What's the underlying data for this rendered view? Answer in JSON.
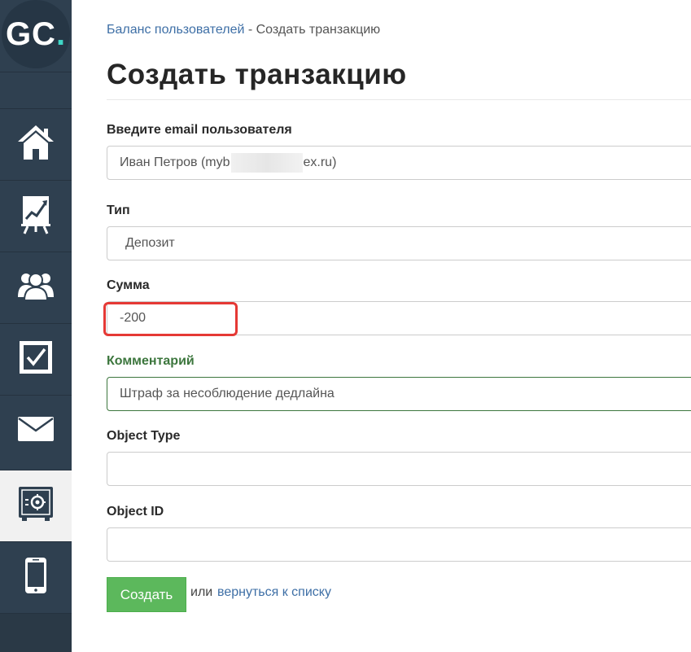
{
  "logo": {
    "letters": "GC",
    "dot": "."
  },
  "sidebar": {
    "items": [
      {
        "icon": "home-icon"
      },
      {
        "icon": "chart-board-icon"
      },
      {
        "icon": "users-icon"
      },
      {
        "icon": "checkbox-icon"
      },
      {
        "icon": "mail-icon"
      },
      {
        "icon": "safe-icon",
        "active": true
      },
      {
        "icon": "mobile-icon"
      }
    ]
  },
  "breadcrumb": {
    "parent": "Баланс пользователей",
    "separator": " - ",
    "current": "Создать транзакцию"
  },
  "page_title": "Создать транзакцию",
  "form": {
    "email": {
      "label": "Введите email пользователя",
      "value_prefix": "Иван Петров (myb",
      "value_suffix": "ex.ru)"
    },
    "type": {
      "label": "Тип",
      "value": "Депозит"
    },
    "amount": {
      "label": "Сумма",
      "value": "-200"
    },
    "comment": {
      "label": "Комментарий",
      "value": "Штраф за несоблюдение дедлайна"
    },
    "object_type": {
      "label": "Object Type",
      "value": ""
    },
    "object_id": {
      "label": "Object ID",
      "value": ""
    }
  },
  "actions": {
    "submit_label": "Создать",
    "or_text": "или",
    "back_link": "вернуться к списку"
  },
  "colors": {
    "sidebar": "#2f4050",
    "link": "#3e6fa6",
    "submit": "#5cb85c",
    "highlight": "#e53935",
    "comment_label": "#3c763d",
    "logo_dot": "#3fd6c6"
  }
}
